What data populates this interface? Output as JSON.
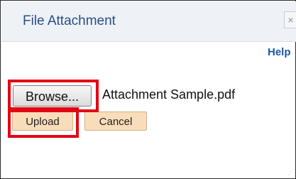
{
  "dialog": {
    "title": "File Attachment",
    "close_label": "×",
    "help_label": "Help"
  },
  "attachment": {
    "browse_label": "Browse...",
    "file_name": "Attachment Sample.pdf"
  },
  "actions": {
    "upload_label": "Upload",
    "cancel_label": "Cancel"
  },
  "icons": {
    "close": "close-icon",
    "resize": "resize-grip-icon"
  },
  "colors": {
    "title_text": "#2a4f86",
    "link": "#1f56a7",
    "action_button_bg": "#f9dcb9",
    "highlight": "#e30613"
  }
}
